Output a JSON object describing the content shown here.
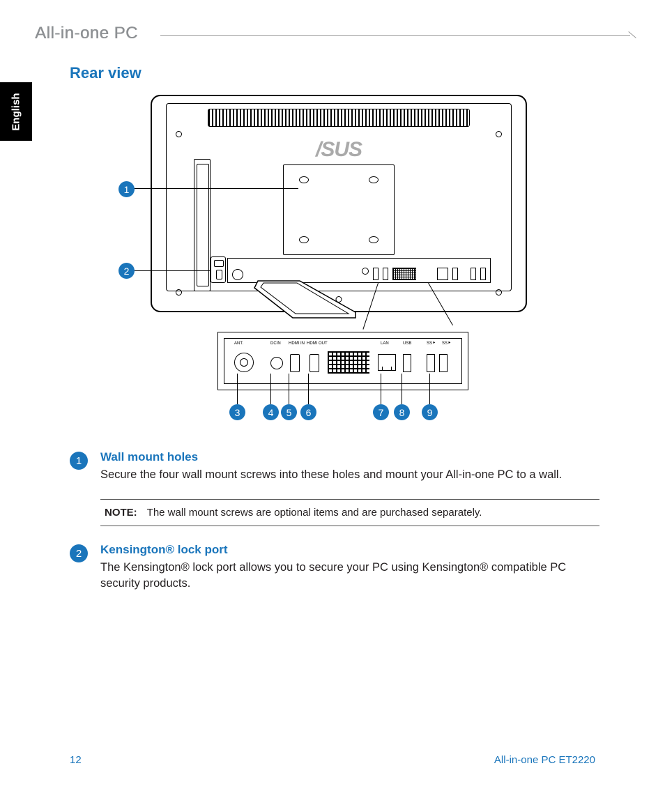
{
  "header": {
    "title": "All-in-one PC"
  },
  "side_tab": "English",
  "section_title": "Rear view",
  "logo_text": "/SUS",
  "callouts_upper": [
    "1",
    "2"
  ],
  "callouts_lower": [
    "3",
    "4",
    "5",
    "6",
    "7",
    "8",
    "9"
  ],
  "port_labels": {
    "ant": "ANT.",
    "dcin": "DCIN",
    "hdmi_in": "HDMI IN",
    "hdmi_out": "HDMI OUT",
    "lan": "LAN",
    "usb": "USB",
    "ss1": "SS⯈",
    "ss2": "SS⯈"
  },
  "items": [
    {
      "num": "1",
      "title": "Wall mount holes",
      "desc": "Secure the four wall mount screws into these holes and mount your All-in-one PC to a wall."
    },
    {
      "num": "2",
      "title": "Kensington® lock port",
      "desc": "The Kensington® lock port allows you to secure your PC using Kensington® compatible PC security products."
    }
  ],
  "note": {
    "label": "NOTE:",
    "text": "The wall mount screws are optional items and are purchased separately."
  },
  "footer": {
    "page": "12",
    "model": "All-in-one PC ET2220"
  }
}
